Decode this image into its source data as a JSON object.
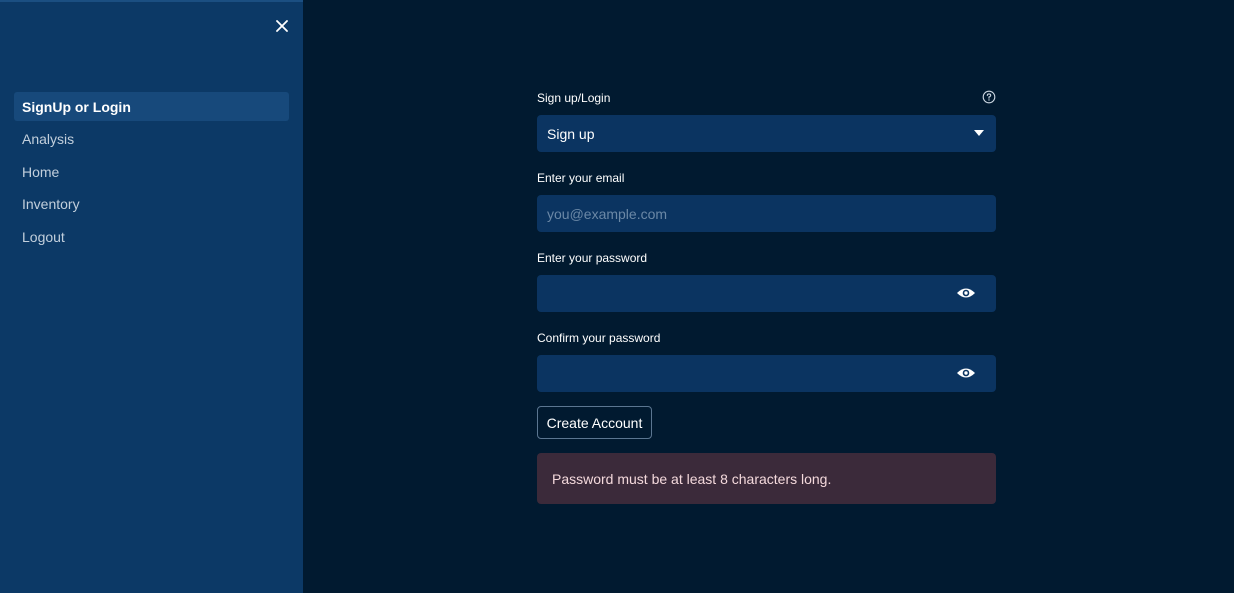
{
  "sidebar": {
    "close_icon": "close-icon",
    "items": [
      {
        "label": "SignUp or Login",
        "active": true
      },
      {
        "label": "Analysis"
      },
      {
        "label": "Home"
      },
      {
        "label": "Inventory"
      },
      {
        "label": "Logout"
      }
    ]
  },
  "form": {
    "mode_label": "Sign up/Login",
    "mode_value": "Sign up",
    "email_label": "Enter your email",
    "email_placeholder": "you@example.com",
    "password_label": "Enter your password",
    "confirm_label": "Confirm your password",
    "submit_label": "Create Account",
    "error_message": "Password must be at least 8 characters long."
  },
  "colors": {
    "background": "#011a30",
    "sidebar": "#0c3966",
    "field": "#0b3461",
    "error_bg": "#3b2a3a"
  }
}
